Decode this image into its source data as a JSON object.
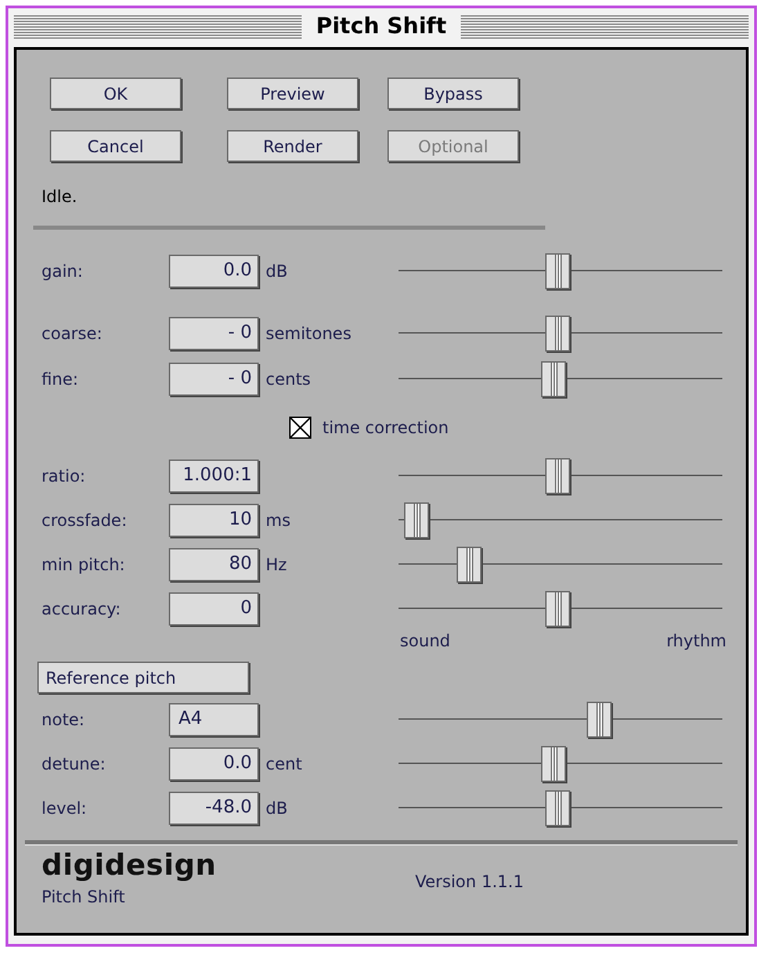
{
  "window": {
    "title": "Pitch Shift"
  },
  "buttons": [
    {
      "label": "OK",
      "disabled": false
    },
    {
      "label": "Preview",
      "disabled": false
    },
    {
      "label": "Bypass",
      "disabled": false
    },
    {
      "label": "Cancel",
      "disabled": false
    },
    {
      "label": "Render",
      "disabled": false
    },
    {
      "label": "Optional",
      "disabled": true
    }
  ],
  "status": "Idle.",
  "pitch_params": [
    {
      "label": "gain:",
      "value": "0.0",
      "unit": "dB",
      "level": 0.49
    },
    {
      "label": "coarse:",
      "value": "- 0",
      "unit": "semitones",
      "level": 0.49
    },
    {
      "label": "fine:",
      "value": "- 0",
      "unit": "cents",
      "level": 0.48
    }
  ],
  "time_correction": {
    "label": "time correction",
    "checked": true
  },
  "time_params": [
    {
      "label": "ratio:",
      "value": "1.000:1",
      "level": 0.49
    },
    {
      "label": "crossfade:",
      "value": "10",
      "unit": "ms",
      "level": 0.056
    },
    {
      "label": "min pitch:",
      "value": "80",
      "unit": "Hz",
      "level": 0.22
    },
    {
      "label": "accuracy:",
      "value": "0",
      "level": 0.49
    }
  ],
  "accuracy_range": {
    "min_label": "sound",
    "max_label": "rhythm"
  },
  "reference_pitch": {
    "label": "Reference pitch"
  },
  "reference_params": [
    {
      "label": "note:",
      "value": "A4",
      "level": 0.62
    },
    {
      "label": "detune:",
      "value": "0.0",
      "unit": "cent",
      "level": 0.48
    },
    {
      "label": "level:",
      "value": "-48.0",
      "unit": "dB",
      "level": 0.49
    }
  ],
  "footer": {
    "brand": "digidesign",
    "plugin_name": "Pitch Shift",
    "version": "Version 1.1.1"
  }
}
